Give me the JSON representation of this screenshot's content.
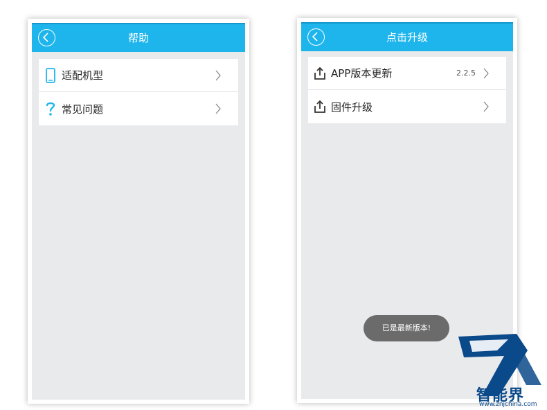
{
  "help_screen": {
    "title": "帮助",
    "items": [
      {
        "label": "适配机型",
        "icon": "phone-icon"
      },
      {
        "label": "常见问题",
        "icon": "question-icon"
      }
    ]
  },
  "upgrade_screen": {
    "title": "点击升级",
    "items": [
      {
        "label": "APP版本更新",
        "value": "2.2.5",
        "icon": "upload-icon"
      },
      {
        "label": "固件升级",
        "icon": "upload-icon"
      }
    ],
    "toast": "已是最新版本!"
  },
  "watermark": {
    "name": "智能界",
    "url": "www.znjchina.com"
  },
  "colors": {
    "accent": "#1eb5ec",
    "background": "#e9eaec",
    "toast": "#6b6b6b",
    "logo": "#0b4a8a"
  }
}
